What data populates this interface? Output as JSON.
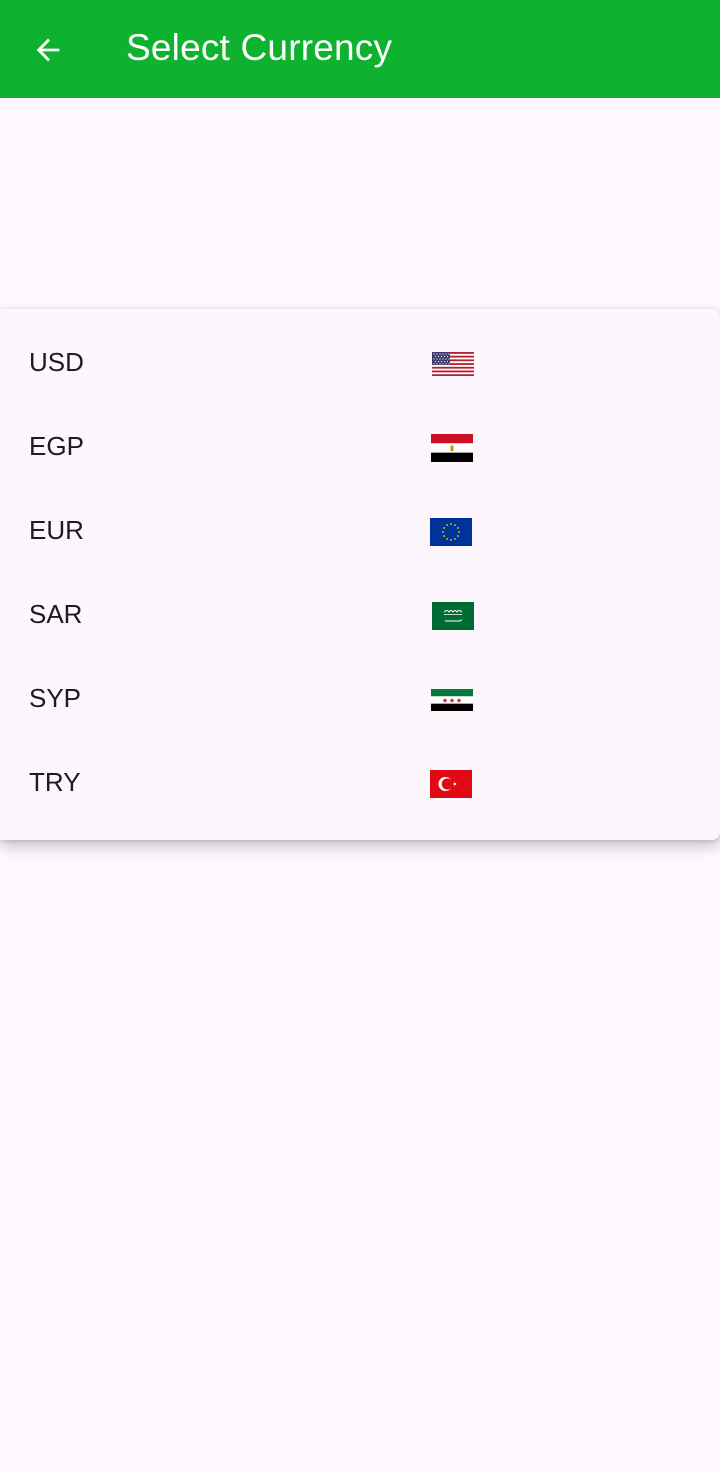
{
  "app_bar": {
    "title": "Select Currency",
    "back_icon": "arrow-left-icon",
    "color": "#0fb22f"
  },
  "currencies": [
    {
      "code": "USD",
      "flag_icon": "us-flag-icon"
    },
    {
      "code": "EGP",
      "flag_icon": "egypt-flag-icon"
    },
    {
      "code": "EUR",
      "flag_icon": "eu-flag-icon"
    },
    {
      "code": "SAR",
      "flag_icon": "saudi-flag-icon"
    },
    {
      "code": "SYP",
      "flag_icon": "syria-flag-icon"
    },
    {
      "code": "TRY",
      "flag_icon": "turkey-flag-icon"
    }
  ]
}
